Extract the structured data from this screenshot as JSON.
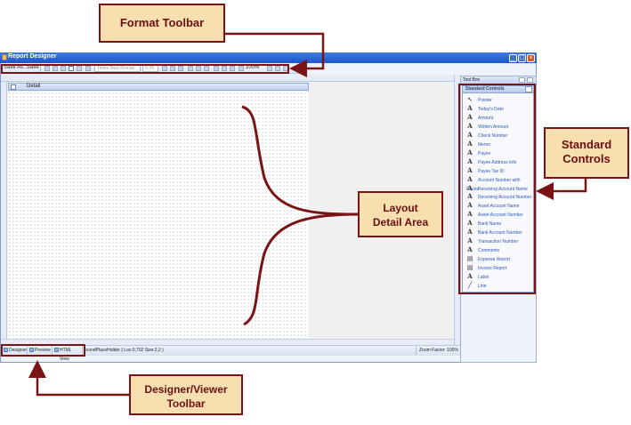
{
  "window": {
    "title": "Report Designer"
  },
  "toolbar": {
    "save_as_label": "Save As...",
    "save_label": "Save",
    "font_placeholder": "Times New Roman",
    "size_placeholder": "9.75",
    "zoom_value": "100%"
  },
  "designer": {
    "section_label": "Detail"
  },
  "statusbar": {
    "tabs": [
      "Designer",
      "Preview",
      "HTML View"
    ],
    "info": "econdPlaceHolder { Loc:0,702 Size:2,2 }",
    "zoom": "Zoom Factor: 100%"
  },
  "toolbox": {
    "title": "Tool Box",
    "section": "Standard Controls",
    "items": [
      {
        "label": "Pointer",
        "icon": "pointer-icon"
      },
      {
        "label": "Today's Date",
        "icon": "text-field-icon"
      },
      {
        "label": "Amount",
        "icon": "text-field-icon"
      },
      {
        "label": "Written Amount",
        "icon": "text-field-icon"
      },
      {
        "label": "Check Number",
        "icon": "text-field-icon"
      },
      {
        "label": "Memo",
        "icon": "text-field-icon"
      },
      {
        "label": "Payee",
        "icon": "text-field-icon"
      },
      {
        "label": "Payee Address Info",
        "icon": "text-field-icon"
      },
      {
        "label": "Payee Tax ID",
        "icon": "text-field-icon"
      },
      {
        "label": "Account Number with Payee",
        "icon": "text-field-icon"
      },
      {
        "label": "Receiving Account Name",
        "icon": "text-field-icon"
      },
      {
        "label": "Receiving Account Number",
        "icon": "text-field-icon"
      },
      {
        "label": "Asset Account Name",
        "icon": "text-field-icon"
      },
      {
        "label": "Asset Account Number",
        "icon": "text-field-icon"
      },
      {
        "label": "Bank Name",
        "icon": "text-field-icon"
      },
      {
        "label": "Bank Account Number",
        "icon": "text-field-icon"
      },
      {
        "label": "Transaction Number",
        "icon": "text-field-icon"
      },
      {
        "label": "Comments",
        "icon": "text-field-icon"
      },
      {
        "label": "Expense Report",
        "icon": "report-icon"
      },
      {
        "label": "Invoice Report",
        "icon": "report-icon"
      },
      {
        "label": "Label",
        "icon": "text-field-icon"
      },
      {
        "label": "Line",
        "icon": "line-icon"
      }
    ]
  },
  "callouts": {
    "format_toolbar": "Format Toolbar",
    "standard_controls_1": "Standard",
    "standard_controls_2": "Controls",
    "layout_1": "Layout",
    "layout_2": "Detail Area",
    "designer_viewer_1": "Designer/Viewer",
    "designer_viewer_2": "Toolbar"
  },
  "colors": {
    "callout_fill": "#f7dfb0",
    "callout_border": "#7a1414",
    "titlebar": "#1e56c8"
  }
}
